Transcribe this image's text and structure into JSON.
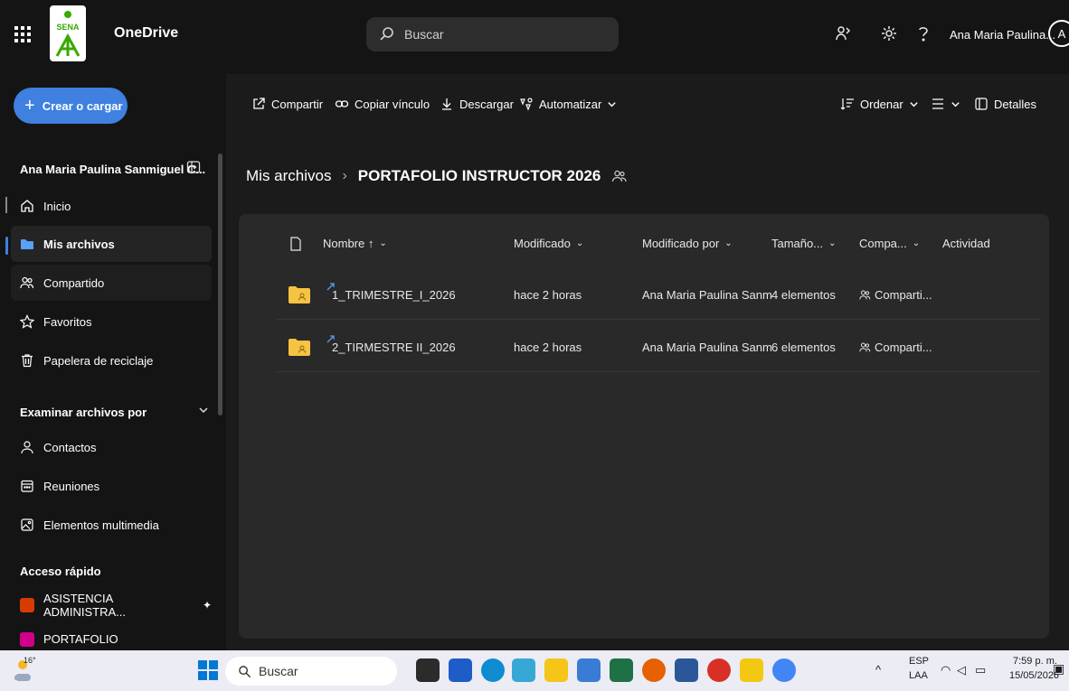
{
  "app": {
    "name": "OneDrive",
    "logo_text": "SENA"
  },
  "search": {
    "placeholder": "Buscar"
  },
  "user": {
    "name": "Ana Maria Paulina...",
    "initial": "A"
  },
  "sidebar": {
    "create_label": "Crear o cargar",
    "account_name": "Ana Maria Paulina Sanmiguel C...",
    "nav": [
      {
        "label": "Inicio",
        "icon": "home-icon"
      },
      {
        "label": "Mis archivos",
        "icon": "folder-icon"
      },
      {
        "label": "Compartido",
        "icon": "people-icon"
      },
      {
        "label": "Favoritos",
        "icon": "star-icon"
      },
      {
        "label": "Papelera de reciclaje",
        "icon": "trash-icon"
      }
    ],
    "browse_heading": "Examinar archivos por",
    "browse": [
      {
        "label": "Contactos",
        "icon": "person-icon"
      },
      {
        "label": "Reuniones",
        "icon": "calendar-icon"
      },
      {
        "label": "Elementos multimedia",
        "icon": "image-icon"
      }
    ],
    "quick_heading": "Acceso rápido",
    "quick": [
      {
        "label": "ASISTENCIA ADMINISTRA...",
        "color": "#d83b01"
      },
      {
        "label": "PORTAFOLIO",
        "color": "#d0008b"
      }
    ]
  },
  "commands": {
    "share": "Compartir",
    "copy_link": "Copiar vínculo",
    "download": "Descargar",
    "automate": "Automatizar",
    "sort": "Ordenar",
    "details": "Detalles"
  },
  "breadcrumb": {
    "root": "Mis archivos",
    "current": "PORTAFOLIO INSTRUCTOR 2026"
  },
  "columns": {
    "name": "Nombre ↑",
    "modified": "Modificado",
    "modified_by": "Modificado por",
    "size": "Tamaño...",
    "sharing": "Compa...",
    "activity": "Actividad"
  },
  "files": [
    {
      "name": "1_TRIMESTRE_I_2026",
      "modified": "hace 2 horas",
      "modified_by": "Ana Maria Paulina Sanm",
      "size": "4 elementos",
      "sharing": "Comparti..."
    },
    {
      "name": "2_TIRMESTRE II_2026",
      "modified": "hace 2 horas",
      "modified_by": "Ana Maria Paulina Sanm",
      "size": "6 elementos",
      "sharing": "Comparti..."
    }
  ],
  "taskbar": {
    "weather": "16°",
    "search": "Buscar",
    "lang_top": "ESP",
    "lang_bottom": "LAA",
    "time": "7:59 p. m.",
    "date": "15/05/2026"
  },
  "colors": {
    "accent": "#3f80e0",
    "folder": "#f6c342",
    "background": "#1b1b1b",
    "panel": "#292929"
  }
}
